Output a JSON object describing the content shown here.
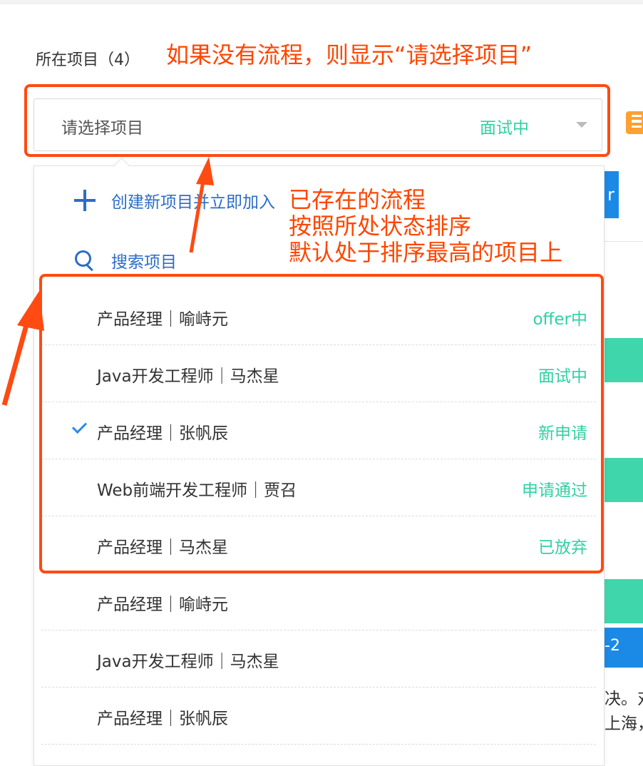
{
  "field": {
    "label": "所在项目（4）"
  },
  "annotations": {
    "title": "如果没有流程，则显示“请选择项目”",
    "lines": [
      "已存在的流程",
      "按照所处状态排序",
      "默认处于排序最高的项目上"
    ]
  },
  "select": {
    "value": "请选择项目",
    "status": "面试中"
  },
  "dropdown": {
    "create_label": "创建新项目并立即加入",
    "search_label": "搜索项目",
    "items": [
      {
        "text": "产品经理｜喻峙元",
        "status": "offer中",
        "checked": false
      },
      {
        "text": "Java开发工程师｜马杰星",
        "status": "面试中",
        "checked": false
      },
      {
        "text": "产品经理｜张帆辰",
        "status": "新申请",
        "checked": true
      },
      {
        "text": "Web前端开发工程师｜贾召",
        "status": "申请通过",
        "checked": false
      },
      {
        "text": "产品经理｜马杰星",
        "status": "已放弃",
        "checked": false
      },
      {
        "text": "产品经理｜喻峙元",
        "status": "",
        "checked": false
      },
      {
        "text": "Java开发工程师｜马杰星",
        "status": "",
        "checked": false
      },
      {
        "text": "产品经理｜张帆辰",
        "status": "",
        "checked": false
      }
    ]
  },
  "background": {
    "btn_fragment": "r",
    "strip_fragment": "-2",
    "text_line_1": "决。对",
    "text_line_2": "上海，"
  },
  "colors": {
    "annotation": "#ff4a12",
    "status": "#2fd1a2",
    "link": "#2a6dc7"
  }
}
